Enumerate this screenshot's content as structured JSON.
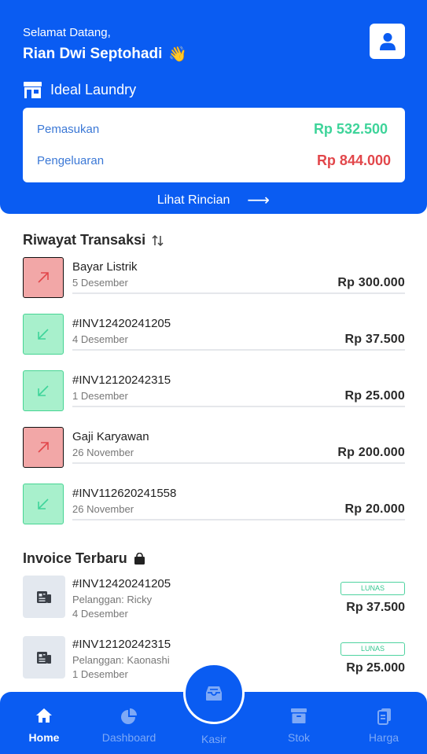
{
  "header": {
    "greeting": "Selamat Datang,",
    "user_name": "Rian Dwi Septohadi",
    "wave_emoji": "👋",
    "store_name": "Ideal Laundry"
  },
  "summary": {
    "income_label": "Pemasukan",
    "income_value": "Rp 532.500",
    "expense_label": "Pengeluaran",
    "expense_value": "Rp 844.000",
    "detail_link": "Lihat Rincian",
    "detail_arrow": "⟶"
  },
  "transactions": {
    "title": "Riwayat Transaksi",
    "items": [
      {
        "name": "Bayar Listrik",
        "date": "5 Desember",
        "amount": "Rp 300.000",
        "type": "out"
      },
      {
        "name": "#INV12420241205",
        "date": "4 Desember",
        "amount": "Rp 37.500",
        "type": "in"
      },
      {
        "name": "#INV12120242315",
        "date": "1 Desember",
        "amount": "Rp 25.000",
        "type": "in"
      },
      {
        "name": "Gaji Karyawan",
        "date": "26 November",
        "amount": "Rp 200.000",
        "type": "out"
      },
      {
        "name": "#INV112620241558",
        "date": "26 November",
        "amount": "Rp 20.000",
        "type": "in"
      }
    ]
  },
  "invoices": {
    "title": "Invoice Terbaru",
    "items": [
      {
        "number": "#INV12420241205",
        "customer": "Pelanggan: Ricky",
        "date": "4 Desember",
        "status": "LUNAS",
        "amount": "Rp 37.500"
      },
      {
        "number": "#INV12120242315",
        "customer": "Pelanggan: Kaonashi",
        "date": "1 Desember",
        "status": "LUNAS",
        "amount": "Rp 25.000"
      }
    ]
  },
  "nav": {
    "home": "Home",
    "dashboard": "Dashboard",
    "kasir": "Kasir",
    "stok": "Stok",
    "harga": "Harga"
  },
  "colors": {
    "primary": "#0a5cf2",
    "income": "#3ed49a",
    "expense": "#e2474b"
  }
}
